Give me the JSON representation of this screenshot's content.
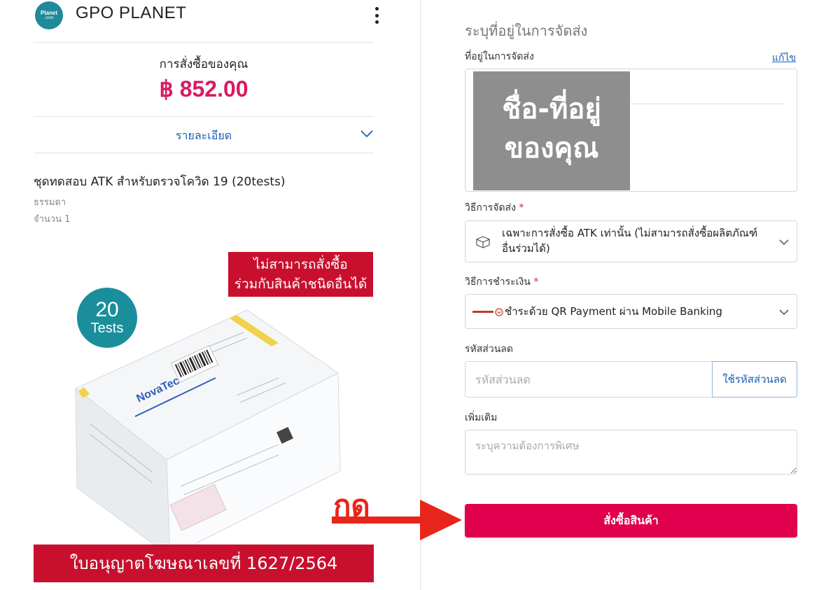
{
  "header": {
    "logo_line1": "Planet",
    "logo_line2": ".com",
    "brand": "GPO PLANET"
  },
  "order": {
    "label": "การสั่งซื้อของคุณ",
    "total": "฿ 852.00",
    "details_label": "รายละเอียด"
  },
  "product": {
    "name": "ชุดทดสอบ ATK สำหรับตรวจโควิด 19 (20tests)",
    "variant": "ธรรมดา",
    "quantity": "จำนวน 1",
    "image": {
      "red_tag_line1": "ไม่สามารถสั่งซื้อ",
      "red_tag_line2": "ร่วมกับสินค้าชนิดอื่นได้",
      "badge_number": "20",
      "badge_text": "Tests",
      "box_brand": "NovaTec",
      "license": "ใบอนุญาตโฆษณาเลขที่ 1627/2564"
    }
  },
  "annotation": {
    "press_text": "กด"
  },
  "shipping": {
    "section_title": "ระบุที่อยู่ในการจัดส่ง",
    "address_label": "ที่อยู่ในการจัดส่ง",
    "edit_link": "แก้ไข",
    "address_mask_line1": "ชื่อ-ที่อยู่",
    "address_mask_line2": "ของคุณ",
    "method_label": "วิธีการจัดส่ง",
    "method_value": "เฉพาะการสั่งซื้อ ATK เท่านั้น (ไม่สามารถสั่งซื้อผลิตภัณฑ์อื่นร่วมได้)",
    "method_icon": "package-icon",
    "payment_label": "วิธีการชำระเงิน",
    "payment_value": "ชำระด้วย QR Payment ผ่าน Mobile Banking",
    "payment_icon": "promptpay-icon",
    "required_mark": "*",
    "coupon_label": "รหัสส่วนลด",
    "coupon_placeholder": "รหัสส่วนลด",
    "coupon_button": "ใช้รหัสส่วนลด",
    "note_label": "เพิ่มเติม",
    "note_placeholder": "ระบุความต้องการพิเศษ",
    "submit_button": "สั่งซื้อสินค้า"
  },
  "colors": {
    "accent": "#e0004d",
    "price": "#d81b60",
    "link": "#1a5fb4",
    "tag_red": "#c8102e",
    "badge_teal": "#1a8f9b",
    "annotation_red": "#e8251a"
  }
}
